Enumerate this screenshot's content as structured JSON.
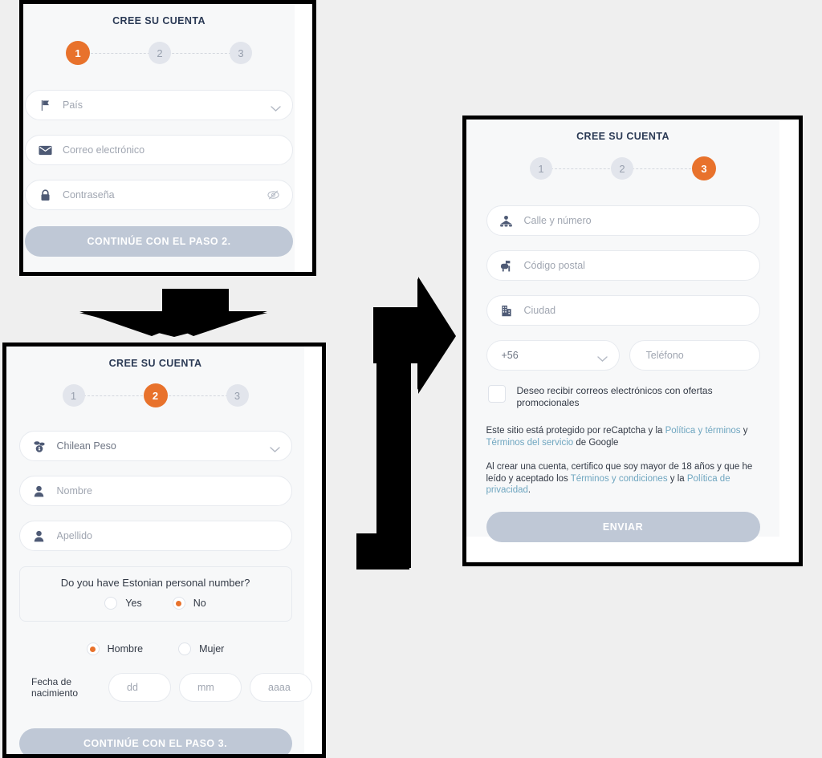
{
  "theme": {
    "background": "#efefef",
    "card_bg": "#f7f8f9",
    "accent_orange": "#e8722c",
    "step_inactive_bg": "#e2e5ec",
    "step_inactive_text": "#98a0ae",
    "title_color": "#2b3a55",
    "placeholder_color": "#a0a6b1",
    "cta_bg": "#bfc8d6",
    "link_color": "#6fa6c0",
    "icon_color": "#4e5a75",
    "border_color": "#e7eaef",
    "frame_color": "#000000"
  },
  "panels": {
    "step1": {
      "title": "CREE SU CUENTA",
      "stepper": {
        "steps": [
          "1",
          "2",
          "3"
        ],
        "active_index": 0
      },
      "fields": [
        {
          "icon": "flag-icon",
          "placeholder": "País",
          "type": "select"
        },
        {
          "icon": "envelope-icon",
          "placeholder": "Correo electrónico",
          "type": "text"
        },
        {
          "icon": "lock-icon",
          "placeholder": "Contraseña",
          "type": "password"
        }
      ],
      "cta_label": "CONTINÚE CON EL PASO 2."
    },
    "step2": {
      "title": "CREE SU CUENTA",
      "stepper": {
        "steps": [
          "1",
          "2",
          "3"
        ],
        "active_index": 1
      },
      "currency": {
        "icon": "coins-icon",
        "value": "Chilean Peso"
      },
      "fields": [
        {
          "icon": "user-icon",
          "placeholder": "Nombre"
        },
        {
          "icon": "user-icon",
          "placeholder": "Apellido"
        }
      ],
      "estonian": {
        "question": "Do you have Estonian personal number?",
        "options": [
          "Yes",
          "No"
        ],
        "selected": "No"
      },
      "gender": {
        "options": [
          "Hombre",
          "Mujer"
        ],
        "selected": "Hombre"
      },
      "dob": {
        "label_line1": "Fecha de",
        "label_line2": "nacimiento",
        "day_placeholder": "dd",
        "month_placeholder": "mm",
        "year_placeholder": "aaaa"
      },
      "cta_label": "CONTINÚE CON EL PASO 3."
    },
    "step3": {
      "title": "CREE SU CUENTA",
      "stepper": {
        "steps": [
          "1",
          "2",
          "3"
        ],
        "active_index": 2
      },
      "fields": [
        {
          "icon": "address-icon",
          "placeholder": "Calle y número"
        },
        {
          "icon": "mailbox-icon",
          "placeholder": "Código postal"
        },
        {
          "icon": "building-icon",
          "placeholder": "Ciudad"
        }
      ],
      "phone": {
        "country_code": "+56",
        "placeholder": "Teléfono"
      },
      "promo_checkbox": {
        "checked": false,
        "label": "Deseo recibir correos electrónicos con ofertas promocionales"
      },
      "recaptcha": {
        "part1": "Este sitio está protegido por reCaptcha y la ",
        "link1": "Política y términos",
        "part2": " y ",
        "link2": "Términos del servicio",
        "part3": " de Google"
      },
      "terms": {
        "part1": "Al crear una cuenta, certifico que soy mayor de 18 años y que he leído y aceptado los ",
        "link1": "Términos y condiciones",
        "part2": " y la ",
        "link2": "Política de privacidad",
        "part3": "."
      },
      "cta_label": "ENVIAR"
    }
  },
  "arrows": {
    "down": {
      "name": "down-arrow",
      "direction": "down"
    },
    "bent_right": {
      "name": "bent-right-arrow",
      "direction": "right"
    }
  }
}
